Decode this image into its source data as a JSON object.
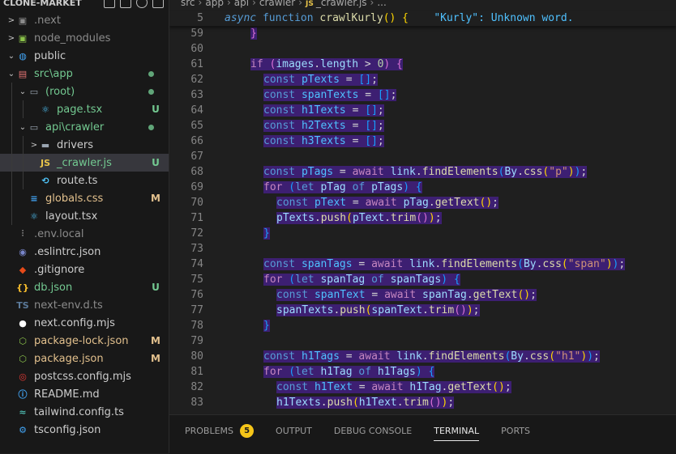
{
  "explorer": {
    "title": "CLONE-MARKET",
    "items": [
      {
        "name": ".next",
        "depth": 0,
        "chev": ">",
        "icon": "folder-next-icon",
        "glyph": "▣",
        "color": "#8b8b8b",
        "text_class": "c-gray",
        "badge": "",
        "dot": false
      },
      {
        "name": "node_modules",
        "depth": 0,
        "chev": ">",
        "icon": "folder-node-icon",
        "glyph": "▣",
        "color": "#8bc34a",
        "text_class": "c-gray",
        "badge": "",
        "dot": false
      },
      {
        "name": "public",
        "depth": 0,
        "chev": "⌄",
        "icon": "folder-public-icon",
        "glyph": "◍",
        "color": "#42a5f5",
        "text_class": "c-white",
        "badge": "",
        "dot": false
      },
      {
        "name": "src\\app",
        "depth": 0,
        "chev": "⌄",
        "icon": "folder-src-icon",
        "glyph": "▤",
        "color": "#e57373",
        "text_class": "c-green",
        "badge": "",
        "dot": true
      },
      {
        "name": "(root)",
        "depth": 1,
        "chev": "⌄",
        "icon": "folder-open-icon",
        "glyph": "▭",
        "color": "#9aa5b1",
        "text_class": "c-green",
        "badge": "",
        "dot": true
      },
      {
        "name": "page.tsx",
        "depth": 2,
        "chev": "",
        "icon": "react-icon",
        "glyph": "⚛",
        "color": "#4fc3f7",
        "text_class": "c-green",
        "badge": "U",
        "dot": false
      },
      {
        "name": "api\\crawler",
        "depth": 1,
        "chev": "⌄",
        "icon": "folder-api-icon",
        "glyph": "▭",
        "color": "#9aa5b1",
        "text_class": "c-green",
        "badge": "",
        "dot": true
      },
      {
        "name": "drivers",
        "depth": 2,
        "chev": ">",
        "icon": "folder-icon",
        "glyph": "▬",
        "color": "#9aa5b1",
        "text_class": "c-white",
        "badge": "",
        "dot": false
      },
      {
        "name": "_crawler.js",
        "depth": 2,
        "chev": "",
        "icon": "javascript-icon",
        "glyph": "JS",
        "color": "#e8c44a",
        "text_class": "c-green",
        "badge": "U",
        "dot": false,
        "active": true
      },
      {
        "name": "route.ts",
        "depth": 2,
        "chev": "",
        "icon": "route-icon",
        "glyph": "⟲",
        "color": "#4fc3f7",
        "text_class": "c-white",
        "badge": "",
        "dot": false
      },
      {
        "name": "globals.css",
        "depth": 1,
        "chev": "",
        "icon": "css-icon",
        "glyph": "≡",
        "color": "#42a5f5",
        "text_class": "c-yellow",
        "badge": "M",
        "dot": false
      },
      {
        "name": "layout.tsx",
        "depth": 1,
        "chev": "",
        "icon": "react-icon",
        "glyph": "⚛",
        "color": "#4fc3f7",
        "text_class": "c-white",
        "badge": "",
        "dot": false
      },
      {
        "name": ".env.local",
        "depth": 0,
        "chev": "",
        "icon": "env-icon",
        "glyph": "⫶",
        "color": "#8b8b8b",
        "text_class": "c-gray",
        "badge": "",
        "dot": false
      },
      {
        "name": ".eslintrc.json",
        "depth": 0,
        "chev": "",
        "icon": "eslint-icon",
        "glyph": "◉",
        "color": "#7986cb",
        "text_class": "c-white",
        "badge": "",
        "dot": false
      },
      {
        "name": ".gitignore",
        "depth": 0,
        "chev": "",
        "icon": "git-icon",
        "glyph": "◆",
        "color": "#e64a19",
        "text_class": "c-white",
        "badge": "",
        "dot": false
      },
      {
        "name": "db.json",
        "depth": 0,
        "chev": "",
        "icon": "json-icon",
        "glyph": "{}",
        "color": "#fbc02d",
        "text_class": "c-green",
        "badge": "U",
        "dot": false
      },
      {
        "name": "next-env.d.ts",
        "depth": 0,
        "chev": "",
        "icon": "ts-def-icon",
        "glyph": "TS",
        "color": "#5b7a9a",
        "text_class": "c-gray",
        "badge": "",
        "dot": false
      },
      {
        "name": "next.config.mjs",
        "depth": 0,
        "chev": "",
        "icon": "nextjs-icon",
        "glyph": "●",
        "color": "#ffffff",
        "text_class": "c-white",
        "badge": "",
        "dot": false
      },
      {
        "name": "package-lock.json",
        "depth": 0,
        "chev": "",
        "icon": "npm-icon",
        "glyph": "⬡",
        "color": "#8bc34a",
        "text_class": "c-yellow",
        "badge": "M",
        "dot": false
      },
      {
        "name": "package.json",
        "depth": 0,
        "chev": "",
        "icon": "npm-icon",
        "glyph": "⬡",
        "color": "#8bc34a",
        "text_class": "c-yellow",
        "badge": "M",
        "dot": false
      },
      {
        "name": "postcss.config.mjs",
        "depth": 0,
        "chev": "",
        "icon": "postcss-icon",
        "glyph": "◎",
        "color": "#e53935",
        "text_class": "c-white",
        "badge": "",
        "dot": false
      },
      {
        "name": "README.md",
        "depth": 0,
        "chev": "",
        "icon": "info-icon",
        "glyph": "ⓘ",
        "color": "#42a5f5",
        "text_class": "c-white",
        "badge": "",
        "dot": false
      },
      {
        "name": "tailwind.config.ts",
        "depth": 0,
        "chev": "",
        "icon": "tailwind-icon",
        "glyph": "≈",
        "color": "#4db6ac",
        "text_class": "c-white",
        "badge": "",
        "dot": false
      },
      {
        "name": "tsconfig.json",
        "depth": 0,
        "chev": "",
        "icon": "tsconfig-icon",
        "glyph": "⚙",
        "color": "#42a5f5",
        "text_class": "c-white",
        "badge": "",
        "dot": false
      }
    ]
  },
  "breadcrumb": [
    "src",
    "app",
    "api",
    "crawler",
    "_crawler.js",
    "..."
  ],
  "sticky": {
    "num": "5",
    "prefix": "async",
    "kw": "function",
    "fname": "crawlKurly",
    "rest": "() {",
    "hint": "\"Kurly\": Unknown word."
  },
  "lines": [
    {
      "num": "59",
      "indent": 2,
      "hl": true,
      "tokens": [
        [
          "}",
          "br2"
        ]
      ]
    },
    {
      "num": "60",
      "indent": 0,
      "hl": false,
      "tokens": []
    },
    {
      "num": "61",
      "indent": 2,
      "hl": true,
      "tokens": [
        [
          "if",
          "k"
        ],
        [
          " (",
          "br2"
        ],
        [
          "images",
          "v"
        ],
        [
          ".",
          "p"
        ],
        [
          "length",
          "v"
        ],
        [
          " > ",
          "p"
        ],
        [
          "0",
          "n"
        ],
        [
          ") ",
          "br2"
        ],
        [
          "{",
          "br2"
        ]
      ]
    },
    {
      "num": "62",
      "indent": 3,
      "hl": true,
      "tokens": [
        [
          "const ",
          "kb"
        ],
        [
          "pTexts",
          "cm"
        ],
        [
          " = ",
          "p"
        ],
        [
          "[]",
          "br3"
        ],
        [
          ";",
          "p"
        ]
      ]
    },
    {
      "num": "63",
      "indent": 3,
      "hl": true,
      "tokens": [
        [
          "const ",
          "kb"
        ],
        [
          "spanTexts",
          "cm"
        ],
        [
          " = ",
          "p"
        ],
        [
          "[]",
          "br3"
        ],
        [
          ";",
          "p"
        ]
      ]
    },
    {
      "num": "64",
      "indent": 3,
      "hl": true,
      "tokens": [
        [
          "const ",
          "kb"
        ],
        [
          "h1Texts",
          "cm"
        ],
        [
          " = ",
          "p"
        ],
        [
          "[]",
          "br3"
        ],
        [
          ";",
          "p"
        ]
      ]
    },
    {
      "num": "65",
      "indent": 3,
      "hl": true,
      "tokens": [
        [
          "const ",
          "kb"
        ],
        [
          "h2Texts",
          "cm"
        ],
        [
          " = ",
          "p"
        ],
        [
          "[]",
          "br3"
        ],
        [
          ";",
          "p"
        ]
      ]
    },
    {
      "num": "66",
      "indent": 3,
      "hl": true,
      "tokens": [
        [
          "const ",
          "kb"
        ],
        [
          "h3Texts",
          "cm"
        ],
        [
          " = ",
          "p"
        ],
        [
          "[]",
          "br3"
        ],
        [
          ";",
          "p"
        ]
      ]
    },
    {
      "num": "67",
      "indent": 0,
      "hl": false,
      "tokens": []
    },
    {
      "num": "68",
      "indent": 3,
      "hl": true,
      "tokens": [
        [
          "const ",
          "kb"
        ],
        [
          "pTags",
          "cm"
        ],
        [
          " = ",
          "p"
        ],
        [
          "await ",
          "k"
        ],
        [
          "link",
          "v"
        ],
        [
          ".",
          "p"
        ],
        [
          "findElements",
          "fn"
        ],
        [
          "(",
          "br3"
        ],
        [
          "By",
          "v"
        ],
        [
          ".",
          "p"
        ],
        [
          "css",
          "fn"
        ],
        [
          "(",
          "br1"
        ],
        [
          "\"p\"",
          "s"
        ],
        [
          ")",
          "br1"
        ],
        [
          ")",
          "br3"
        ],
        [
          ";",
          "p"
        ]
      ]
    },
    {
      "num": "69",
      "indent": 3,
      "hl": true,
      "tokens": [
        [
          "for",
          "k"
        ],
        [
          " (",
          "br3"
        ],
        [
          "let ",
          "kb"
        ],
        [
          "pTag",
          "v"
        ],
        [
          " of ",
          "kb"
        ],
        [
          "pTags",
          "v"
        ],
        [
          ")",
          "br3"
        ],
        [
          " {",
          "br3"
        ]
      ]
    },
    {
      "num": "70",
      "indent": 4,
      "hl": true,
      "tokens": [
        [
          "const ",
          "kb"
        ],
        [
          "pText",
          "cm"
        ],
        [
          " = ",
          "p"
        ],
        [
          "await ",
          "k"
        ],
        [
          "pTag",
          "v"
        ],
        [
          ".",
          "p"
        ],
        [
          "getText",
          "fn"
        ],
        [
          "()",
          "br1"
        ],
        [
          ";",
          "p"
        ]
      ]
    },
    {
      "num": "71",
      "indent": 4,
      "hl": true,
      "tokens": [
        [
          "pTexts",
          "v"
        ],
        [
          ".",
          "p"
        ],
        [
          "push",
          "fn"
        ],
        [
          "(",
          "br1"
        ],
        [
          "pText",
          "v"
        ],
        [
          ".",
          "p"
        ],
        [
          "trim",
          "fn"
        ],
        [
          "()",
          "br2"
        ],
        [
          ")",
          "br1"
        ],
        [
          ";",
          "p"
        ]
      ]
    },
    {
      "num": "72",
      "indent": 3,
      "hl": true,
      "tokens": [
        [
          "}",
          "br3"
        ]
      ]
    },
    {
      "num": "73",
      "indent": 0,
      "hl": false,
      "tokens": []
    },
    {
      "num": "74",
      "indent": 3,
      "hl": true,
      "tokens": [
        [
          "const ",
          "kb"
        ],
        [
          "spanTags",
          "cm"
        ],
        [
          " = ",
          "p"
        ],
        [
          "await ",
          "k"
        ],
        [
          "link",
          "v"
        ],
        [
          ".",
          "p"
        ],
        [
          "findElements",
          "fn"
        ],
        [
          "(",
          "br3"
        ],
        [
          "By",
          "v"
        ],
        [
          ".",
          "p"
        ],
        [
          "css",
          "fn"
        ],
        [
          "(",
          "br1"
        ],
        [
          "\"span\"",
          "s"
        ],
        [
          ")",
          "br1"
        ],
        [
          ")",
          "br3"
        ],
        [
          ";",
          "p"
        ]
      ]
    },
    {
      "num": "75",
      "indent": 3,
      "hl": true,
      "tokens": [
        [
          "for",
          "k"
        ],
        [
          " (",
          "br3"
        ],
        [
          "let ",
          "kb"
        ],
        [
          "spanTag",
          "v"
        ],
        [
          " of ",
          "kb"
        ],
        [
          "spanTags",
          "v"
        ],
        [
          ")",
          "br3"
        ],
        [
          " {",
          "br3"
        ]
      ]
    },
    {
      "num": "76",
      "indent": 4,
      "hl": true,
      "tokens": [
        [
          "const ",
          "kb"
        ],
        [
          "spanText",
          "cm"
        ],
        [
          " = ",
          "p"
        ],
        [
          "await ",
          "k"
        ],
        [
          "spanTag",
          "v"
        ],
        [
          ".",
          "p"
        ],
        [
          "getText",
          "fn"
        ],
        [
          "()",
          "br1"
        ],
        [
          ";",
          "p"
        ]
      ]
    },
    {
      "num": "77",
      "indent": 4,
      "hl": true,
      "tokens": [
        [
          "spanTexts",
          "v"
        ],
        [
          ".",
          "p"
        ],
        [
          "push",
          "fn"
        ],
        [
          "(",
          "br1"
        ],
        [
          "spanText",
          "v"
        ],
        [
          ".",
          "p"
        ],
        [
          "trim",
          "fn"
        ],
        [
          "()",
          "br2"
        ],
        [
          ")",
          "br1"
        ],
        [
          ";",
          "p"
        ]
      ]
    },
    {
      "num": "78",
      "indent": 3,
      "hl": true,
      "tokens": [
        [
          "}",
          "br3"
        ]
      ]
    },
    {
      "num": "79",
      "indent": 0,
      "hl": false,
      "tokens": []
    },
    {
      "num": "80",
      "indent": 3,
      "hl": true,
      "tokens": [
        [
          "const ",
          "kb"
        ],
        [
          "h1Tags",
          "cm"
        ],
        [
          " = ",
          "p"
        ],
        [
          "await ",
          "k"
        ],
        [
          "link",
          "v"
        ],
        [
          ".",
          "p"
        ],
        [
          "findElements",
          "fn"
        ],
        [
          "(",
          "br3"
        ],
        [
          "By",
          "v"
        ],
        [
          ".",
          "p"
        ],
        [
          "css",
          "fn"
        ],
        [
          "(",
          "br1"
        ],
        [
          "\"h1\"",
          "s"
        ],
        [
          ")",
          "br1"
        ],
        [
          ")",
          "br3"
        ],
        [
          ";",
          "p"
        ]
      ]
    },
    {
      "num": "81",
      "indent": 3,
      "hl": true,
      "tokens": [
        [
          "for",
          "k"
        ],
        [
          " (",
          "br3"
        ],
        [
          "let ",
          "kb"
        ],
        [
          "h1Tag",
          "v"
        ],
        [
          " of ",
          "kb"
        ],
        [
          "h1Tags",
          "v"
        ],
        [
          ")",
          "br3"
        ],
        [
          " {",
          "br3"
        ]
      ]
    },
    {
      "num": "82",
      "indent": 4,
      "hl": true,
      "tokens": [
        [
          "const ",
          "kb"
        ],
        [
          "h1Text",
          "cm"
        ],
        [
          " = ",
          "p"
        ],
        [
          "await ",
          "k"
        ],
        [
          "h1Tag",
          "v"
        ],
        [
          ".",
          "p"
        ],
        [
          "getText",
          "fn"
        ],
        [
          "()",
          "br1"
        ],
        [
          ";",
          "p"
        ]
      ]
    },
    {
      "num": "83",
      "indent": 4,
      "hl": true,
      "tokens": [
        [
          "h1Texts",
          "v"
        ],
        [
          ".",
          "p"
        ],
        [
          "push",
          "fn"
        ],
        [
          "(",
          "br1"
        ],
        [
          "h1Text",
          "v"
        ],
        [
          ".",
          "p"
        ],
        [
          "trim",
          "fn"
        ],
        [
          "()",
          "br2"
        ],
        [
          ")",
          "br1"
        ],
        [
          ";",
          "p"
        ]
      ]
    }
  ],
  "panel": {
    "tabs": [
      {
        "label": "PROBLEMS",
        "badge": "5",
        "active": false
      },
      {
        "label": "OUTPUT",
        "badge": "",
        "active": false
      },
      {
        "label": "DEBUG CONSOLE",
        "badge": "",
        "active": false
      },
      {
        "label": "TERMINAL",
        "badge": "",
        "active": true
      },
      {
        "label": "PORTS",
        "badge": "",
        "active": false
      }
    ]
  },
  "colors": {
    "highlight": "#3d1f72",
    "git_untracked": "#73c991",
    "git_modified": "#e2c08d",
    "problems_badge": "#f5c518"
  }
}
